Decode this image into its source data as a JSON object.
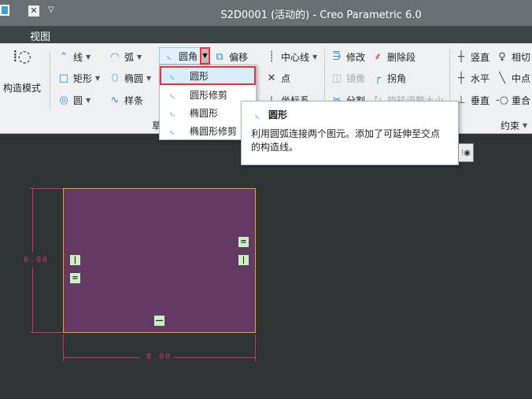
{
  "window": {
    "title": "S2D0001 (活动的) - Creo Parametric 6.0"
  },
  "menu": {
    "view": "视图"
  },
  "ribbon": {
    "construction_mode": "构造模式",
    "line": "线",
    "arc": "弧",
    "fillet": "圆角",
    "offset": "偏移",
    "centerline": "中心线",
    "rectangle": "矩形",
    "ellipse": "椭圆",
    "point": "点",
    "circle": "圆",
    "spline": "样条",
    "coordsys": "坐标系",
    "modify": "修改",
    "delete_segment": "删除段",
    "mirror": "镜像",
    "corner": "拐角",
    "divide": "分割",
    "rotate_resize": "旋转调整大小",
    "vertical": "竖直",
    "tangent": "相切",
    "horizontal": "水平",
    "midpoint": "中点",
    "perpendicular": "垂直",
    "coincident": "重合",
    "sketch_group": "草绘",
    "constrain_group": "约束"
  },
  "dropdown": {
    "items": [
      {
        "label": "圆形",
        "selected": true
      },
      {
        "label": "圆形修剪"
      },
      {
        "label": "椭圆形"
      },
      {
        "label": "椭圆形修剪"
      }
    ]
  },
  "tooltip": {
    "title": "圆形",
    "body": "利用圆弧连接两个图元。添加了可延伸至交点的构造线。"
  },
  "sketch": {
    "dim_height": "6.00",
    "dim_width": "8.00"
  },
  "colors": {
    "accent": "#2a8fd0",
    "highlight": "#e8323c",
    "sketch_fill": "#643a64",
    "sketch_edge": "#f0a020",
    "dimension": "#d0306a"
  }
}
